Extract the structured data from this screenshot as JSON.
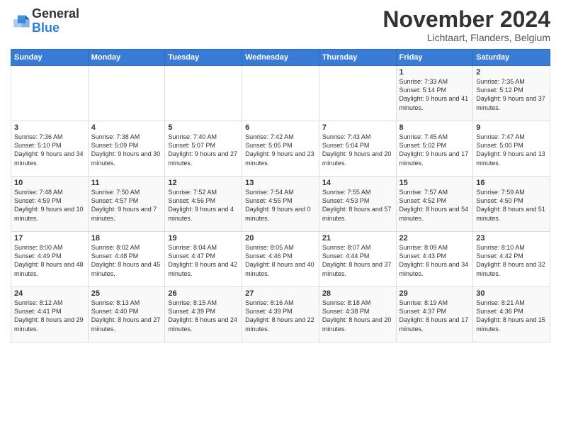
{
  "header": {
    "logo_line1": "General",
    "logo_line2": "Blue",
    "month": "November 2024",
    "location": "Lichtaart, Flanders, Belgium"
  },
  "days_of_week": [
    "Sunday",
    "Monday",
    "Tuesday",
    "Wednesday",
    "Thursday",
    "Friday",
    "Saturday"
  ],
  "weeks": [
    [
      {
        "day": "",
        "info": ""
      },
      {
        "day": "",
        "info": ""
      },
      {
        "day": "",
        "info": ""
      },
      {
        "day": "",
        "info": ""
      },
      {
        "day": "",
        "info": ""
      },
      {
        "day": "1",
        "info": "Sunrise: 7:33 AM\nSunset: 5:14 PM\nDaylight: 9 hours\nand 41 minutes."
      },
      {
        "day": "2",
        "info": "Sunrise: 7:35 AM\nSunset: 5:12 PM\nDaylight: 9 hours\nand 37 minutes."
      }
    ],
    [
      {
        "day": "3",
        "info": "Sunrise: 7:36 AM\nSunset: 5:10 PM\nDaylight: 9 hours\nand 34 minutes."
      },
      {
        "day": "4",
        "info": "Sunrise: 7:38 AM\nSunset: 5:09 PM\nDaylight: 9 hours\nand 30 minutes."
      },
      {
        "day": "5",
        "info": "Sunrise: 7:40 AM\nSunset: 5:07 PM\nDaylight: 9 hours\nand 27 minutes."
      },
      {
        "day": "6",
        "info": "Sunrise: 7:42 AM\nSunset: 5:05 PM\nDaylight: 9 hours\nand 23 minutes."
      },
      {
        "day": "7",
        "info": "Sunrise: 7:43 AM\nSunset: 5:04 PM\nDaylight: 9 hours\nand 20 minutes."
      },
      {
        "day": "8",
        "info": "Sunrise: 7:45 AM\nSunset: 5:02 PM\nDaylight: 9 hours\nand 17 minutes."
      },
      {
        "day": "9",
        "info": "Sunrise: 7:47 AM\nSunset: 5:00 PM\nDaylight: 9 hours\nand 13 minutes."
      }
    ],
    [
      {
        "day": "10",
        "info": "Sunrise: 7:48 AM\nSunset: 4:59 PM\nDaylight: 9 hours\nand 10 minutes."
      },
      {
        "day": "11",
        "info": "Sunrise: 7:50 AM\nSunset: 4:57 PM\nDaylight: 9 hours\nand 7 minutes."
      },
      {
        "day": "12",
        "info": "Sunrise: 7:52 AM\nSunset: 4:56 PM\nDaylight: 9 hours\nand 4 minutes."
      },
      {
        "day": "13",
        "info": "Sunrise: 7:54 AM\nSunset: 4:55 PM\nDaylight: 9 hours\nand 0 minutes."
      },
      {
        "day": "14",
        "info": "Sunrise: 7:55 AM\nSunset: 4:53 PM\nDaylight: 8 hours\nand 57 minutes."
      },
      {
        "day": "15",
        "info": "Sunrise: 7:57 AM\nSunset: 4:52 PM\nDaylight: 8 hours\nand 54 minutes."
      },
      {
        "day": "16",
        "info": "Sunrise: 7:59 AM\nSunset: 4:50 PM\nDaylight: 8 hours\nand 51 minutes."
      }
    ],
    [
      {
        "day": "17",
        "info": "Sunrise: 8:00 AM\nSunset: 4:49 PM\nDaylight: 8 hours\nand 48 minutes."
      },
      {
        "day": "18",
        "info": "Sunrise: 8:02 AM\nSunset: 4:48 PM\nDaylight: 8 hours\nand 45 minutes."
      },
      {
        "day": "19",
        "info": "Sunrise: 8:04 AM\nSunset: 4:47 PM\nDaylight: 8 hours\nand 42 minutes."
      },
      {
        "day": "20",
        "info": "Sunrise: 8:05 AM\nSunset: 4:46 PM\nDaylight: 8 hours\nand 40 minutes."
      },
      {
        "day": "21",
        "info": "Sunrise: 8:07 AM\nSunset: 4:44 PM\nDaylight: 8 hours\nand 37 minutes."
      },
      {
        "day": "22",
        "info": "Sunrise: 8:09 AM\nSunset: 4:43 PM\nDaylight: 8 hours\nand 34 minutes."
      },
      {
        "day": "23",
        "info": "Sunrise: 8:10 AM\nSunset: 4:42 PM\nDaylight: 8 hours\nand 32 minutes."
      }
    ],
    [
      {
        "day": "24",
        "info": "Sunrise: 8:12 AM\nSunset: 4:41 PM\nDaylight: 8 hours\nand 29 minutes."
      },
      {
        "day": "25",
        "info": "Sunrise: 8:13 AM\nSunset: 4:40 PM\nDaylight: 8 hours\nand 27 minutes."
      },
      {
        "day": "26",
        "info": "Sunrise: 8:15 AM\nSunset: 4:39 PM\nDaylight: 8 hours\nand 24 minutes."
      },
      {
        "day": "27",
        "info": "Sunrise: 8:16 AM\nSunset: 4:39 PM\nDaylight: 8 hours\nand 22 minutes."
      },
      {
        "day": "28",
        "info": "Sunrise: 8:18 AM\nSunset: 4:38 PM\nDaylight: 8 hours\nand 20 minutes."
      },
      {
        "day": "29",
        "info": "Sunrise: 8:19 AM\nSunset: 4:37 PM\nDaylight: 8 hours\nand 17 minutes."
      },
      {
        "day": "30",
        "info": "Sunrise: 8:21 AM\nSunset: 4:36 PM\nDaylight: 8 hours\nand 15 minutes."
      }
    ]
  ]
}
